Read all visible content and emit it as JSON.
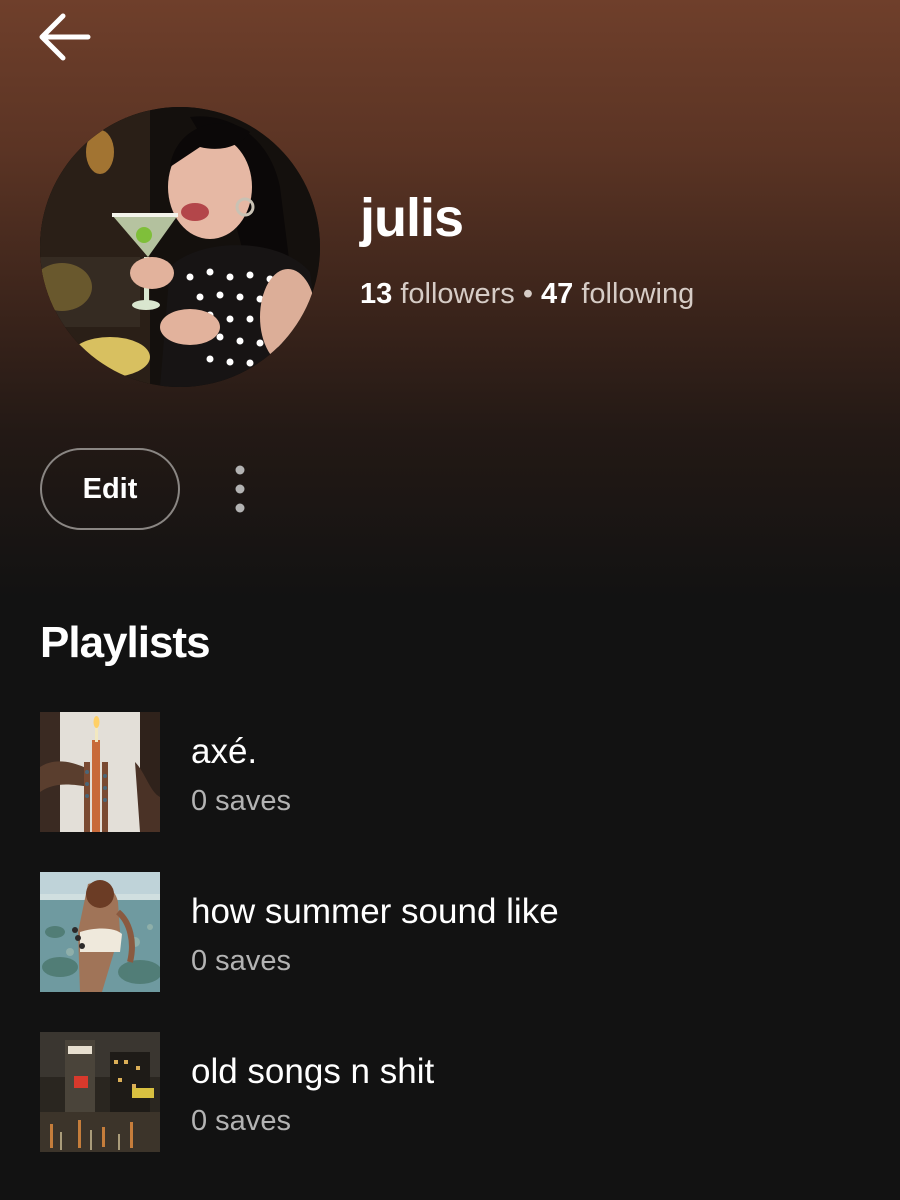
{
  "header": {
    "back_icon": "arrow-left-icon",
    "gradient_color": "#6f3f2b",
    "background_color": "#121212"
  },
  "profile": {
    "name": "julis",
    "avatar_icon": "profile-photo",
    "followers_count": "13",
    "followers_label": "followers",
    "separator": "•",
    "following_count": "47",
    "following_label": "following"
  },
  "actions": {
    "edit_label": "Edit",
    "more_icon": "more-vertical-icon"
  },
  "playlists": {
    "title": "Playlists",
    "items": [
      {
        "name": "axé.",
        "meta": "0 saves"
      },
      {
        "name": "how summer sound like",
        "meta": "0 saves"
      },
      {
        "name": "old songs n shit",
        "meta": "0 saves"
      }
    ]
  },
  "colors": {
    "text_primary": "#ffffff",
    "text_secondary": "#b3b3b3"
  }
}
